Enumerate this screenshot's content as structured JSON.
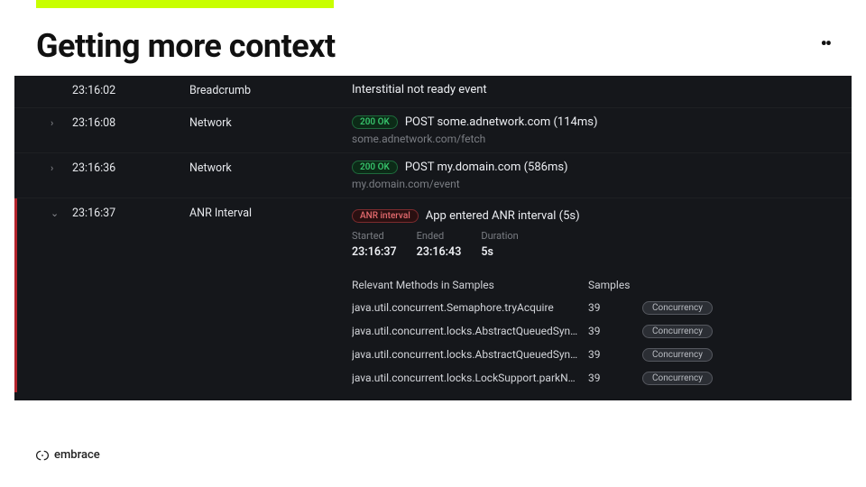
{
  "heading": "Getting more context",
  "brand": "embrace",
  "pills": {
    "ok": "200 OK",
    "anr": "ANR interval",
    "concurrency": "Concurrency"
  },
  "anr_labels": {
    "started": "Started",
    "ended": "Ended",
    "duration": "Duration",
    "methods_header": "Relevant Methods in Samples",
    "samples_header": "Samples"
  },
  "rows": [
    {
      "chev": "",
      "ts": "23:16:02",
      "type": "Breadcrumb",
      "main": "Interstitial not ready event",
      "sub": "",
      "pill": ""
    },
    {
      "chev": "›",
      "ts": "23:16:08",
      "type": "Network",
      "main": "POST some.adnetwork.com (114ms)",
      "sub": "some.adnetwork.com/fetch",
      "pill": "ok"
    },
    {
      "chev": "›",
      "ts": "23:16:36",
      "type": "Network",
      "main": "POST my.domain.com (586ms)",
      "sub": "my.domain.com/event",
      "pill": "ok"
    }
  ],
  "expanded": {
    "chev": "⌄",
    "ts": "23:16:37",
    "type": "ANR Interval",
    "main": "App entered ANR interval (5s)",
    "started": "23:16:37",
    "ended": "23:16:43",
    "duration": "5s",
    "methods": [
      {
        "name": "java.util.concurrent.Semaphore.tryAcquire",
        "samples": "39"
      },
      {
        "name": "java.util.concurrent.locks.AbstractQueuedSynchro...",
        "samples": "39"
      },
      {
        "name": "java.util.concurrent.locks.AbstractQueuedSynchro...",
        "samples": "39"
      },
      {
        "name": "java.util.concurrent.locks.LockSupport.parkNanos",
        "samples": "39"
      }
    ]
  }
}
